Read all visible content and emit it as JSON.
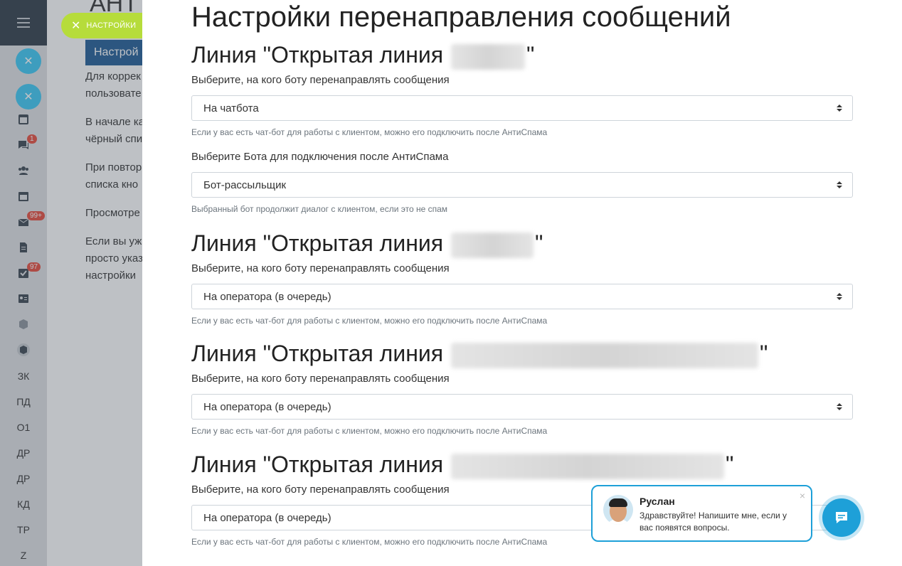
{
  "background": {
    "title": "АНТ",
    "tab_button": "Настрой",
    "paragraphs": [
      [
        "Для коррек",
        "пользовате"
      ],
      [
        "В начале ка",
        "чёрный спи"
      ],
      [
        "При повтор",
        "списка кно"
      ],
      [
        "Просмотре"
      ],
      [
        "Если вы уж",
        "просто указ",
        "настройки"
      ]
    ]
  },
  "sidebar": {
    "badges": {
      "chat": "1",
      "mail": "99+",
      "tasks": "97"
    },
    "text_items": [
      "ЗК",
      "ПД",
      "О1",
      "ДР",
      "ДР",
      "КД",
      "ТР",
      "Z"
    ]
  },
  "close_pill": {
    "label": "НАСТРОЙКИ"
  },
  "panel": {
    "title": "Настройки перенаправления сообщений",
    "sections": [
      {
        "heading_prefix": "Линия \"Открытая линия",
        "heading_suffix": "\"",
        "label1": "Выберите, на кого боту перенаправлять сообщения",
        "select1": "На чатбота",
        "hint1": "Если у вас есть чат-бот для работы с клиентом, можно его подключить после АнтиСпама",
        "label2": "Выберите Бота для подключения после АнтиСпама",
        "select2": "Бот-рассыльщик",
        "hint2": "Выбранный бот продолжит диалог с клиентом, если это не спам"
      },
      {
        "heading_prefix": "Линия \"Открытая линия",
        "heading_suffix": "\"",
        "label1": "Выберите, на кого боту перенаправлять сообщения",
        "select1": "На оператора (в очередь)",
        "hint1": "Если у вас есть чат-бот для работы с клиентом, можно его подключить после АнтиСпама"
      },
      {
        "heading_prefix": "Линия \"Открытая линия",
        "heading_suffix": "\"",
        "label1": "Выберите, на кого боту перенаправлять сообщения",
        "select1": "На оператора (в очередь)",
        "hint1": "Если у вас есть чат-бот для работы с клиентом, можно его подключить после АнтиСпама"
      },
      {
        "heading_prefix": "Линия \"Открытая линия",
        "heading_suffix": "\"",
        "label1": "Выберите, на кого боту перенаправлять сообщения",
        "select1": "На оператора (в очередь)",
        "hint1": "Если у вас есть чат-бот для работы с клиентом, можно его подключить после АнтиСпама"
      }
    ]
  },
  "chat": {
    "name": "Руслан",
    "message": "Здравствуйте! Напишите мне, если у вас появятся вопросы.",
    "close": "×"
  },
  "colors": {
    "accent_green": "#b6dc3b",
    "chat_blue": "#1ea0d8",
    "topbar": "#2f3b47"
  }
}
